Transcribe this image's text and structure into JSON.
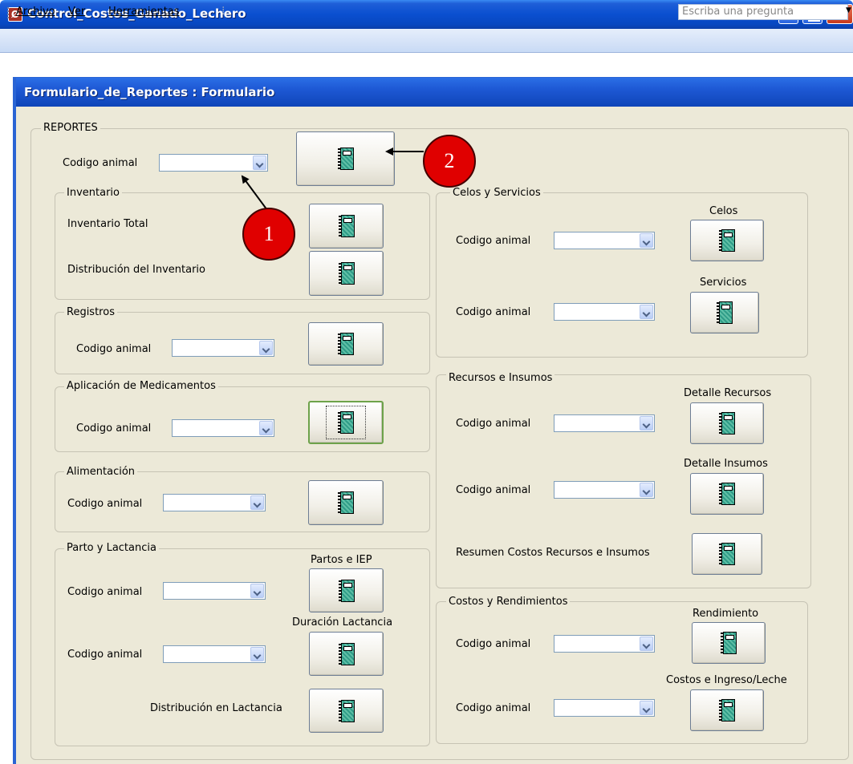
{
  "window": {
    "title": "Control_Costos_Ganado_Lechero",
    "icon": "access-app-icon"
  },
  "menu": {
    "archivo": "Archivo",
    "ver": "Ver",
    "herramientas": "Herramientas",
    "help_placeholder": "Escriba una pregunta"
  },
  "form": {
    "title": "Formulario_de_Reportes : Formulario",
    "reportes_label": "REPORTES",
    "top_codigo_label": "Codigo animal",
    "inventario": {
      "title": "Inventario",
      "total_label": "Inventario Total",
      "distribucion_label": "Distribución del Inventario"
    },
    "registros": {
      "title": "Registros",
      "codigo_label": "Codigo animal"
    },
    "medicamentos": {
      "title": "Aplicación de Medicamentos",
      "codigo_label": "Codigo animal"
    },
    "alimentacion": {
      "title": "Alimentación",
      "codigo_label": "Codigo animal"
    },
    "parto": {
      "title": "Parto y Lactancia",
      "codigo1_label": "Codigo animal",
      "partos_label": "Partos e IEP",
      "codigo2_label": "Codigo animal",
      "duracion_label": "Duración Lactancia",
      "distribucion_label": "Distribución en Lactancia"
    },
    "celos": {
      "title": "Celos y Servicios",
      "codigo1_label": "Codigo animal",
      "celos_label": "Celos",
      "codigo2_label": "Codigo animal",
      "servicios_label": "Servicios"
    },
    "recursos": {
      "title": "Recursos e Insumos",
      "codigo1_label": "Codigo animal",
      "detalle_recursos_label": "Detalle Recursos",
      "codigo2_label": "Codigo animal",
      "detalle_insumos_label": "Detalle Insumos",
      "resumen_label": "Resumen Costos Recursos e Insumos"
    },
    "costos": {
      "title": "Costos y Rendimientos",
      "codigo1_label": "Codigo animal",
      "rendimiento_label": "Rendimiento",
      "codigo2_label": "Codigo animal",
      "costos_label": "Costos e Ingreso/Leche"
    }
  },
  "annotations": {
    "one": "1",
    "two": "2"
  },
  "icons": {
    "report_button_icon": "notebook-icon"
  },
  "colors": {
    "title_bar": "#0a4fd0",
    "form_bg": "#ece9d8",
    "callout": "#e00000"
  }
}
